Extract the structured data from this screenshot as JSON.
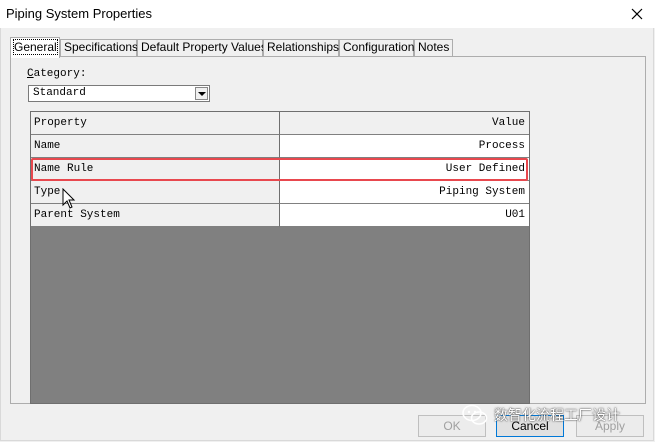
{
  "window": {
    "title": "Piping System Properties"
  },
  "tabs": [
    {
      "label": "General"
    },
    {
      "label": "Specifications"
    },
    {
      "label": "Default Property Values"
    },
    {
      "label": "Relationships"
    },
    {
      "label": "Configuration"
    },
    {
      "label": "Notes"
    }
  ],
  "category": {
    "label_prefix": "",
    "label_hotkey": "C",
    "label_rest": "ategory:",
    "value": "Standard"
  },
  "grid": {
    "header": {
      "property": "Property",
      "value": "Value"
    },
    "rows": [
      {
        "property": "Name",
        "value": "Process"
      },
      {
        "property": "Name Rule",
        "value": "User Defined"
      },
      {
        "property": "Type",
        "value": "Piping System"
      },
      {
        "property": "Parent System",
        "value": "U01"
      }
    ]
  },
  "buttons": {
    "ok": "OK",
    "cancel": "Cancel",
    "apply": "Apply"
  },
  "watermark": {
    "text": "数智化流程工厂设计"
  },
  "colors": {
    "highlight": "#e8484e",
    "grid_empty": "#808080"
  }
}
